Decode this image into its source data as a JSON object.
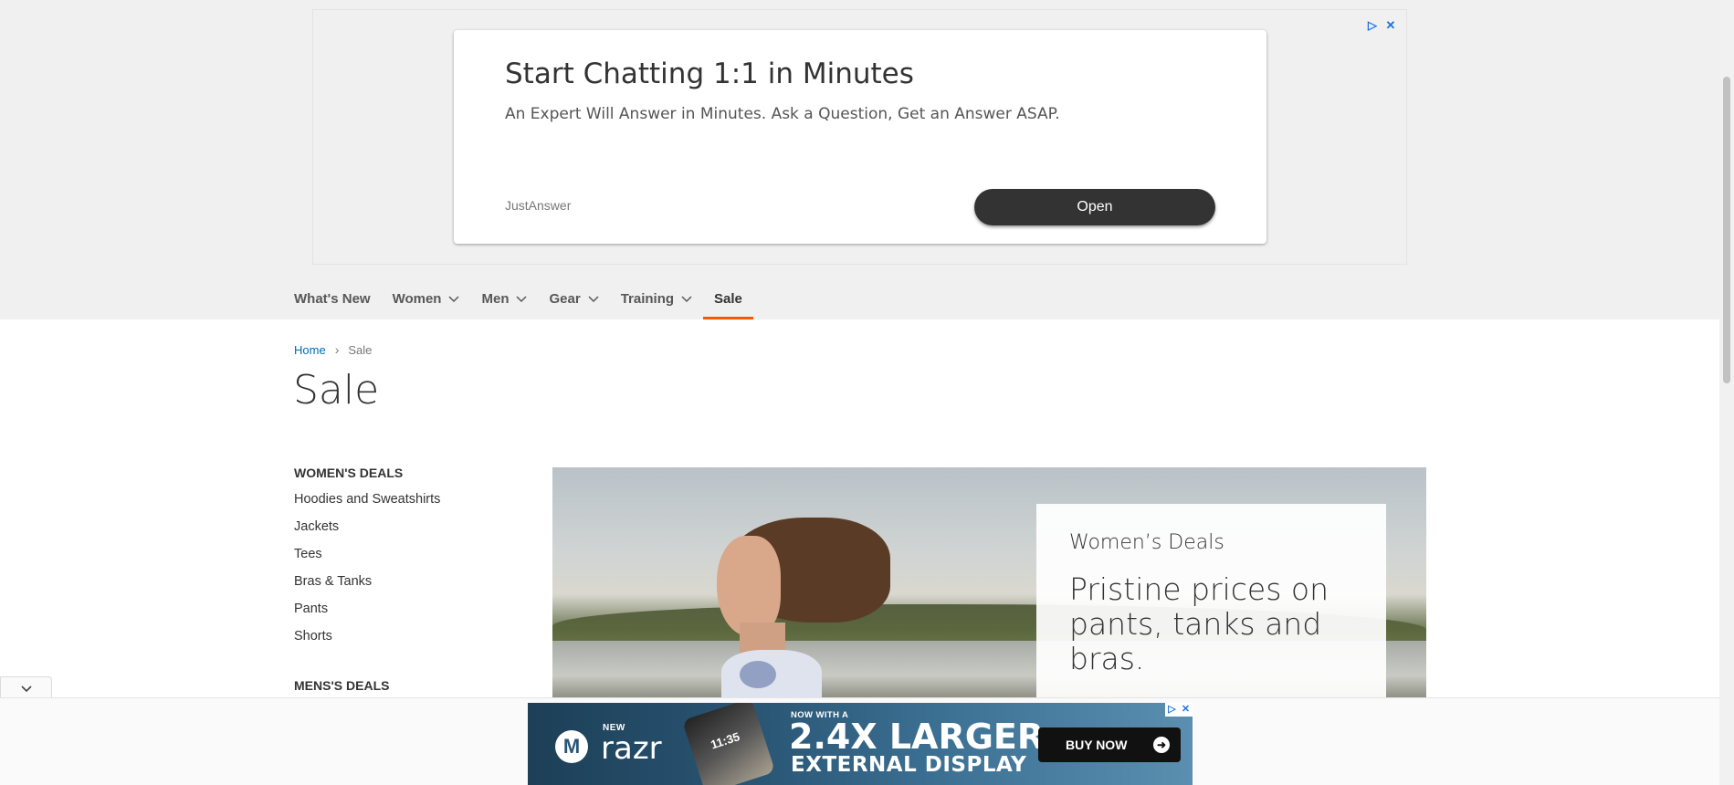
{
  "top_ad": {
    "title": "Start Chatting 1:1 in Minutes",
    "description": "An Expert Will Answer in Minutes. Ask a Question, Get an Answer ASAP.",
    "brand": "JustAnswer",
    "cta": "Open",
    "adchoices_icon": "▷",
    "close_icon": "✕"
  },
  "nav": {
    "items": [
      {
        "label": "What's New",
        "has_dropdown": false
      },
      {
        "label": "Women",
        "has_dropdown": true
      },
      {
        "label": "Men",
        "has_dropdown": true
      },
      {
        "label": "Gear",
        "has_dropdown": true
      },
      {
        "label": "Training",
        "has_dropdown": true
      },
      {
        "label": "Sale",
        "has_dropdown": false,
        "active": true
      }
    ],
    "accent_color": "#ff5501"
  },
  "breadcrumb": {
    "home": "Home",
    "separator": "›",
    "current": "Sale"
  },
  "page_title": "Sale",
  "sidebar": {
    "womens_heading": "WOMEN'S DEALS",
    "womens_items": [
      "Hoodies and Sweatshirts",
      "Jackets",
      "Tees",
      "Bras & Tanks",
      "Pants",
      "Shorts"
    ],
    "mens_heading": "MENS'S DEALS"
  },
  "hero": {
    "kicker": "Women’s Deals",
    "headline": "Pristine prices on pants, tanks and bras."
  },
  "bottom_ad": {
    "logo": "M",
    "new_label": "NEW",
    "product": "razr",
    "phone_time": "11:35",
    "small_line": "NOW WITH A",
    "big_line": "2.4X LARGER",
    "ext_line": "EXTERNAL DISPLAY",
    "cta": "BUY NOW",
    "cta_arrow": "➜"
  },
  "collapse_icon": "chevron-down-icon"
}
